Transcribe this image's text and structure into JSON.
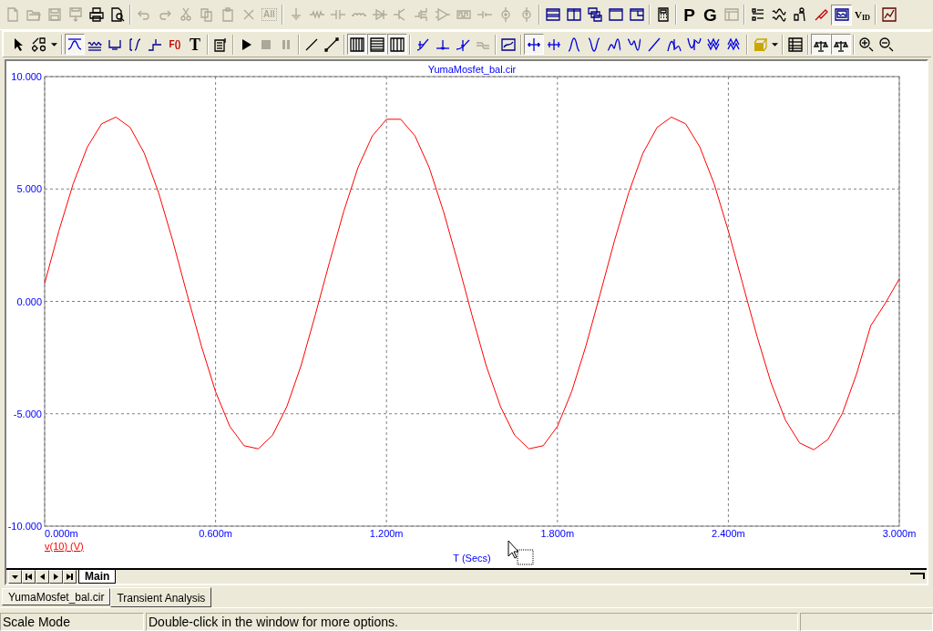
{
  "toolbars": [
    {
      "groups": [
        [
          {
            "disabled": true,
            "pressed": false
          },
          {
            "disabled": true,
            "pressed": false
          },
          {
            "disabled": true,
            "pressed": false
          },
          {
            "disabled": true,
            "pressed": false
          },
          {
            "disabled": false,
            "pressed": false
          },
          {
            "disabled": false,
            "pressed": false
          }
        ],
        [
          {
            "disabled": true,
            "pressed": false
          },
          {
            "disabled": true,
            "pressed": false
          },
          {
            "disabled": true,
            "pressed": false
          },
          {
            "disabled": true,
            "pressed": false
          },
          {
            "disabled": true,
            "pressed": false
          },
          {
            "disabled": true,
            "pressed": false
          },
          {
            "disabled": true,
            "pressed": false,
            "label": "All"
          }
        ],
        [
          {
            "disabled": true,
            "pressed": false
          },
          {
            "disabled": true,
            "pressed": false
          },
          {
            "disabled": true,
            "pressed": false
          },
          {
            "disabled": true,
            "pressed": false
          },
          {
            "disabled": true,
            "pressed": false
          },
          {
            "disabled": true,
            "pressed": false
          },
          {
            "disabled": true,
            "pressed": false
          },
          {
            "disabled": true,
            "pressed": false
          },
          {
            "disabled": true,
            "pressed": false
          },
          {
            "disabled": true,
            "pressed": false
          },
          {
            "disabled": true,
            "pressed": false
          },
          {
            "disabled": true,
            "pressed": false
          }
        ],
        [
          {
            "disabled": false,
            "pressed": false
          },
          {
            "disabled": false,
            "pressed": false
          },
          {
            "disabled": false,
            "pressed": false
          },
          {
            "disabled": false,
            "pressed": false
          },
          {
            "disabled": false,
            "pressed": false
          }
        ],
        [
          {
            "disabled": false,
            "pressed": false
          }
        ],
        [
          {
            "disabled": false,
            "pressed": false,
            "label": "P"
          },
          {
            "disabled": false,
            "pressed": false,
            "label": "G"
          },
          {
            "disabled": true,
            "pressed": false
          }
        ],
        [
          {
            "disabled": false,
            "pressed": false
          },
          {
            "disabled": false,
            "pressed": false
          },
          {
            "disabled": false,
            "pressed": false
          },
          {
            "disabled": false,
            "pressed": false
          },
          {
            "disabled": false,
            "pressed": true
          },
          {
            "disabled": false,
            "pressed": false,
            "label": "V$_{ID}$"
          }
        ],
        [
          {
            "disabled": false,
            "pressed": false
          }
        ]
      ]
    },
    {
      "groups": [
        [
          {
            "disabled": false,
            "pressed": false
          },
          {
            "disabled": false,
            "pressed": false
          },
          {
            "disabled": false,
            "pressed": false
          }
        ],
        [
          {
            "disabled": false,
            "pressed": true
          },
          {
            "disabled": false,
            "pressed": false
          },
          {
            "disabled": false,
            "pressed": false
          },
          {
            "disabled": false,
            "pressed": false
          },
          {
            "disabled": false,
            "pressed": false
          },
          {
            "disabled": false,
            "pressed": false,
            "label": "F()"
          },
          {
            "disabled": false,
            "pressed": false,
            "label": "T"
          }
        ],
        [
          {
            "disabled": false,
            "pressed": false
          }
        ],
        [
          {
            "disabled": false,
            "pressed": false
          },
          {
            "disabled": true,
            "pressed": false
          },
          {
            "disabled": true,
            "pressed": false
          }
        ],
        [
          {
            "disabled": false,
            "pressed": false
          },
          {
            "disabled": false,
            "pressed": false
          }
        ],
        [
          {
            "disabled": false,
            "pressed": true
          },
          {
            "disabled": false,
            "pressed": true
          },
          {
            "disabled": false,
            "pressed": true
          }
        ],
        [
          {
            "disabled": false,
            "pressed": false
          },
          {
            "disabled": false,
            "pressed": false
          },
          {
            "disabled": false,
            "pressed": false
          },
          {
            "disabled": true,
            "pressed": false
          }
        ],
        [
          {
            "disabled": false,
            "pressed": false
          }
        ],
        [
          {
            "disabled": false,
            "pressed": true
          },
          {
            "disabled": false,
            "pressed": false
          },
          {
            "disabled": false,
            "pressed": false
          },
          {
            "disabled": false,
            "pressed": false
          },
          {
            "disabled": false,
            "pressed": false
          },
          {
            "disabled": false,
            "pressed": false
          },
          {
            "disabled": false,
            "pressed": false
          },
          {
            "disabled": false,
            "pressed": false
          },
          {
            "disabled": false,
            "pressed": false
          },
          {
            "disabled": false,
            "pressed": false
          },
          {
            "disabled": false,
            "pressed": false
          }
        ],
        [
          {
            "disabled": false,
            "pressed": false
          },
          {
            "disabled": false,
            "pressed": false
          }
        ],
        [
          {
            "disabled": false,
            "pressed": false
          }
        ],
        [
          {
            "disabled": false,
            "pressed": true
          },
          {
            "disabled": false,
            "pressed": true
          }
        ],
        [
          {
            "disabled": false,
            "pressed": false
          },
          {
            "disabled": false,
            "pressed": false
          }
        ]
      ]
    }
  ],
  "plot": {
    "chart_data": {
      "type": "line",
      "grid": true,
      "title": "YumaMosfet_bal.cir",
      "xlabel": "T (Secs)",
      "x": [
        0,
        0.05,
        0.1,
        0.15,
        0.2,
        0.25,
        0.3,
        0.35,
        0.4,
        0.45,
        0.5,
        0.55,
        0.6,
        0.65,
        0.7,
        0.75,
        0.8,
        0.85,
        0.9,
        0.95,
        1.0,
        1.05,
        1.1,
        1.15,
        1.2,
        1.25,
        1.3,
        1.35,
        1.4,
        1.45,
        1.5,
        1.55,
        1.6,
        1.65,
        1.7,
        1.75,
        1.8,
        1.85,
        1.9,
        1.95,
        2.0,
        2.05,
        2.1,
        2.15,
        2.2,
        2.25,
        2.3,
        2.35,
        2.4,
        2.45,
        2.5,
        2.55,
        2.6,
        2.65,
        2.7,
        2.75,
        2.8,
        2.85,
        2.9,
        2.95,
        3.0
      ],
      "series": [
        {
          "name": "v(10) (V)",
          "color": "#ff0000",
          "values": [
            0.8,
            3.13,
            5.23,
            6.87,
            7.9,
            8.2,
            7.74,
            6.59,
            4.83,
            2.68,
            0.32,
            -1.98,
            -4.02,
            -5.56,
            -6.42,
            -6.56,
            -5.96,
            -4.68,
            -2.86,
            -0.61,
            1.75,
            4.01,
            5.95,
            7.36,
            8.1,
            8.1,
            7.36,
            5.95,
            4.01,
            1.75,
            -0.61,
            -2.86,
            -4.68,
            -5.96,
            -6.56,
            -6.42,
            -5.56,
            -4.02,
            -1.98,
            0.33,
            2.68,
            4.83,
            6.59,
            7.74,
            8.2,
            7.9,
            6.87,
            5.23,
            3.13,
            0.8,
            -1.53,
            -3.63,
            -5.27,
            -6.3,
            -6.6,
            -6.14,
            -4.99,
            -3.23,
            -1.08,
            -0.1,
            1.0
          ]
        }
      ],
      "xlim": [
        0,
        3
      ],
      "ylim": [
        -10,
        10
      ],
      "xticks": [
        {
          "value": 0,
          "label": "0.000m"
        },
        {
          "value": 0.6,
          "label": "0.600m"
        },
        {
          "value": 1.2,
          "label": "1.200m"
        },
        {
          "value": 1.8,
          "label": "1.800m"
        },
        {
          "value": 2.4,
          "label": "2.400m"
        },
        {
          "value": 3,
          "label": "3.000m"
        }
      ],
      "yticks": [
        {
          "value": -10,
          "label": "-10.000"
        },
        {
          "value": -5,
          "label": "-5.000"
        },
        {
          "value": 0,
          "label": "0.000"
        },
        {
          "value": 5,
          "label": "5.000"
        },
        {
          "value": 10,
          "label": "10.000"
        }
      ]
    }
  },
  "sheet_tabs": [
    {
      "label": "Main",
      "selected": true
    }
  ],
  "document_tabs": [
    {
      "label": "YumaMosfet_bal.cir",
      "selected": false
    },
    {
      "label": "Transient Analysis",
      "selected": true
    }
  ],
  "status_bar": [
    "Scale Mode",
    "Double-click in the window for more options."
  ]
}
